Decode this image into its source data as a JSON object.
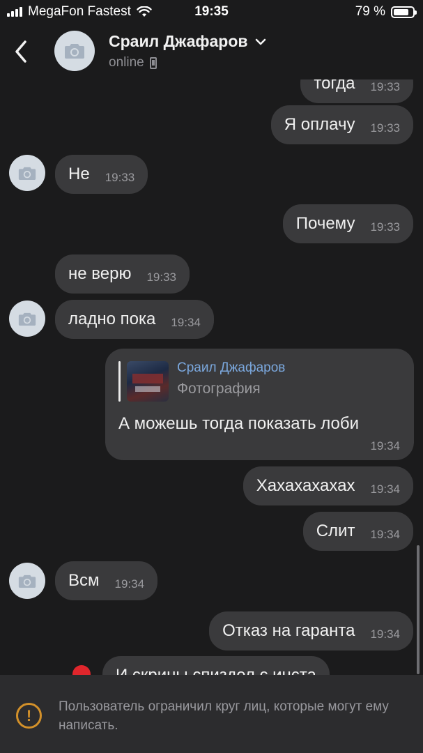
{
  "status_bar": {
    "carrier": "MegaFon Fastest",
    "time": "19:35",
    "battery": "79 %",
    "battery_level": 0.79
  },
  "header": {
    "name": "Сраил Джафаров",
    "status": "online"
  },
  "messages": [
    {
      "text": "тогда",
      "time": "19:33",
      "outgoing": true
    },
    {
      "text": "Я оплачу",
      "time": "19:33",
      "outgoing": true
    },
    {
      "text": "Не",
      "time": "19:33",
      "outgoing": false
    },
    {
      "text": "Почему",
      "time": "19:33",
      "outgoing": true
    },
    {
      "text": "не верю",
      "time": "19:33",
      "outgoing": false
    },
    {
      "text": "ладно пока",
      "time": "19:34",
      "outgoing": false
    },
    {
      "reply_to": {
        "name": "Сраил Джафаров",
        "type": "Фотография"
      },
      "text": "А можешь тогда показать лоби",
      "time": "19:34",
      "outgoing": true
    },
    {
      "text": "Хахахахахах",
      "time": "19:34",
      "outgoing": true
    },
    {
      "text": "Слит",
      "time": "19:34",
      "outgoing": true
    },
    {
      "text": "Всм",
      "time": "19:34",
      "outgoing": false
    },
    {
      "text": "Отказ на гаранта",
      "time": "19:34",
      "outgoing": true
    },
    {
      "text": "И скрины спиздел с инста",
      "time": "",
      "outgoing": true,
      "failed": true
    }
  ],
  "restriction_notice": "Пользователь ограничил круг лиц, которые могут ему написать.",
  "colors": {
    "background": "#1b1b1c",
    "bubble": "#3a3a3c",
    "link_name": "#7ba8de",
    "warning": "#d2902a",
    "error": "#e0262c"
  }
}
